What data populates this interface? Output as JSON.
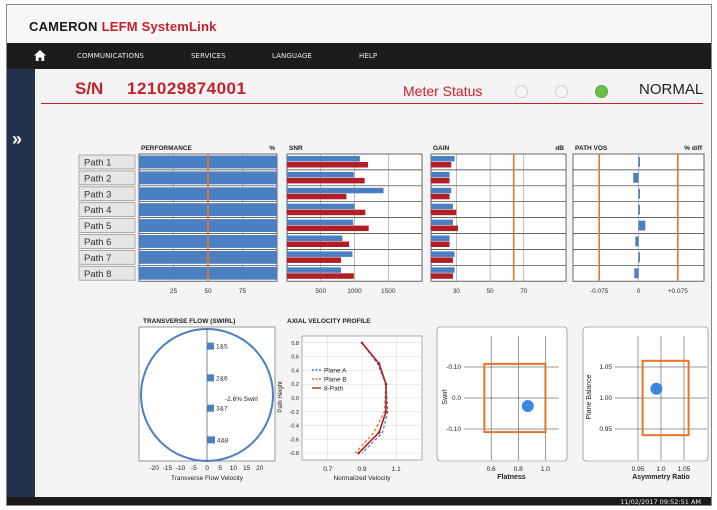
{
  "brand": {
    "part1": "CAMERON",
    "part2": "LEFM SystemLink"
  },
  "nav": {
    "items": [
      "COMMUNICATIONS",
      "SERVICES",
      "LANGUAGE",
      "HELP"
    ]
  },
  "header": {
    "sn_label": "S/N",
    "sn_value": "121029874001",
    "meter_status_label": "Meter Status",
    "status_text": "NORMAL",
    "status_color": "#6cc04a"
  },
  "timestamp": "11/02/2017 09:52:51 AM",
  "paths": [
    "Path 1",
    "Path 2",
    "Path 3",
    "Path 4",
    "Path 5",
    "Path 6",
    "Path 7",
    "Path 8"
  ],
  "colors": {
    "blue": "#4a7fc1",
    "red": "#b31e24",
    "orange": "#e8742c",
    "navy": "#23314b"
  },
  "chart_data": [
    {
      "type": "bar",
      "title": "PERFORMANCE",
      "unit": "%",
      "categories": [
        "Path 1",
        "Path 2",
        "Path 3",
        "Path 4",
        "Path 5",
        "Path 6",
        "Path 7",
        "Path 8"
      ],
      "values": [
        100,
        100,
        100,
        100,
        100,
        100,
        100,
        100
      ],
      "xlim": [
        0,
        100
      ],
      "ticks": [
        "25",
        "50",
        "75"
      ],
      "tick_values": [
        25,
        50,
        75
      ],
      "reference_value": 50
    },
    {
      "type": "bar",
      "title": "SNR",
      "categories": [
        "Path 1",
        "Path 2",
        "Path 3",
        "Path 4",
        "Path 5",
        "Path 6",
        "Path 7",
        "Path 8"
      ],
      "xlim": [
        0,
        2000
      ],
      "ticks": [
        "500",
        "1000",
        "1500"
      ],
      "tick_values": [
        500,
        1000,
        1500
      ],
      "series": [
        {
          "values": [
            1080,
            990,
            1430,
            1000,
            980,
            820,
            970,
            800
          ]
        },
        {
          "values": [
            1200,
            1150,
            880,
            1160,
            1210,
            920,
            800,
            990
          ]
        }
      ]
    },
    {
      "type": "bar",
      "title": "GAIN",
      "unit": "dB",
      "categories": [
        "Path 1",
        "Path 2",
        "Path 3",
        "Path 4",
        "Path 5",
        "Path 6",
        "Path 7",
        "Path 8"
      ],
      "xlim": [
        15,
        95
      ],
      "ticks": [
        "30",
        "50",
        "70"
      ],
      "tick_values": [
        30,
        50,
        70
      ],
      "reference_value": 64,
      "series": [
        {
          "values": [
            29,
            26,
            27,
            28,
            28,
            26,
            29,
            29
          ]
        },
        {
          "values": [
            27,
            26,
            26,
            30,
            31,
            26,
            28,
            28
          ]
        }
      ]
    },
    {
      "type": "bar",
      "title": "PATH VOS",
      "unit": "% diff",
      "categories": [
        "Path 1",
        "Path 2",
        "Path 3",
        "Path 4",
        "Path 5",
        "Path 6",
        "Path 7",
        "Path 8"
      ],
      "xlim": [
        -0.125,
        0.125
      ],
      "ticks": [
        "-0.075",
        "0",
        "+0.075"
      ],
      "tick_values": [
        -0.075,
        0,
        0.075
      ],
      "reference_values": [
        -0.075,
        0.075
      ],
      "values": [
        0,
        -0.01,
        0.002,
        0.0,
        0.013,
        -0.006,
        0.001,
        -0.008
      ]
    },
    {
      "type": "scatter",
      "title": "TRANSVERSE FLOW (SWIRL)",
      "xlabel": "Transverse Flow Velocity",
      "x_ticks": [
        "-20",
        "-15",
        "-10",
        "-5",
        "0",
        "5",
        "10",
        "15",
        "20"
      ],
      "tick_values": [
        -20,
        -15,
        -10,
        -5,
        0,
        5,
        10,
        15,
        20
      ],
      "xlim": [
        -25,
        25
      ],
      "pairs": [
        {
          "label": "1&5",
          "value": 0.2,
          "row": 0.13
        },
        {
          "label": "2&6",
          "value": 0,
          "row": 0.37
        },
        {
          "label": "3&7",
          "value": 0.5,
          "row": 0.6
        },
        {
          "label": "4&8",
          "value": 1.5,
          "row": 0.84
        }
      ],
      "annotation": "-2.6% Swirl"
    },
    {
      "type": "line",
      "title": "AXIAL VELOCITY PROFILE",
      "xlabel": "Normalized Velocity",
      "ylabel": "Path Height",
      "xlim": [
        0.55,
        1.25
      ],
      "ylim": [
        -0.9,
        0.9
      ],
      "x_ticks": [
        "0.7",
        "0.9",
        "1.1"
      ],
      "x_tick_values": [
        0.7,
        0.9,
        1.1
      ],
      "y_ticks": [
        "0.8",
        "0.6",
        "0.4",
        "0.2",
        "0.0",
        "-0.2",
        "-0.4",
        "-0.6",
        "-0.8"
      ],
      "y_tick_values": [
        0.8,
        0.6,
        0.4,
        0.2,
        0.0,
        -0.2,
        -0.4,
        -0.6,
        -0.8
      ],
      "legend": [
        "Plane A",
        "Plane B",
        "8-Path"
      ],
      "series": [
        {
          "name": "Plane A",
          "color": "#4a7fc1",
          "x": [
            0.9,
            0.99,
            1.04,
            1.05,
            1.02,
            0.9
          ],
          "y": [
            0.8,
            0.5,
            0.2,
            -0.2,
            -0.5,
            -0.8
          ]
        },
        {
          "name": "Plane B",
          "color": "#e8742c",
          "x": [
            0.9,
            1.0,
            1.04,
            1.03,
            0.97,
            0.86
          ],
          "y": [
            0.8,
            0.5,
            0.2,
            -0.2,
            -0.5,
            -0.8
          ]
        },
        {
          "name": "8-Path",
          "color": "#b31e24",
          "x": [
            0.9,
            1.0,
            1.04,
            1.04,
            1.0,
            0.88
          ],
          "y": [
            0.8,
            0.5,
            0.2,
            -0.2,
            -0.5,
            -0.8
          ]
        }
      ]
    },
    {
      "type": "scatter",
      "xlabel": "Flatness",
      "ylabel": "Swirl",
      "xlim": [
        0.4,
        1.1
      ],
      "ylim": [
        -0.2,
        0.2
      ],
      "x_ticks": [
        "0.6",
        "0.8",
        "1.0"
      ],
      "x_tick_values": [
        0.6,
        0.8,
        1.0
      ],
      "y_ticks": [
        "-0.10",
        "0.0",
        "-0.10"
      ],
      "y_tick_values": [
        0.1,
        0.0,
        -0.1
      ],
      "limit_box": {
        "x": [
          0.55,
          1.0
        ],
        "y": [
          -0.11,
          0.11
        ]
      },
      "point": {
        "x": 0.87,
        "y": -0.026
      }
    },
    {
      "type": "scatter",
      "xlabel": "Asymmetry Ratio",
      "ylabel": "Plane Balance",
      "xlim": [
        0.9,
        1.1
      ],
      "ylim": [
        0.9,
        1.1
      ],
      "x_ticks": [
        "0.95",
        "1.0",
        "1.05"
      ],
      "x_tick_values": [
        0.95,
        1.0,
        1.05
      ],
      "y_ticks": [
        "1.05",
        "1.00",
        "0.95"
      ],
      "y_tick_values": [
        1.05,
        1.0,
        0.95
      ],
      "limit_box": {
        "x": [
          0.96,
          1.06
        ],
        "y": [
          0.94,
          1.06
        ]
      },
      "point": {
        "x": 0.99,
        "y": 1.015
      }
    }
  ]
}
